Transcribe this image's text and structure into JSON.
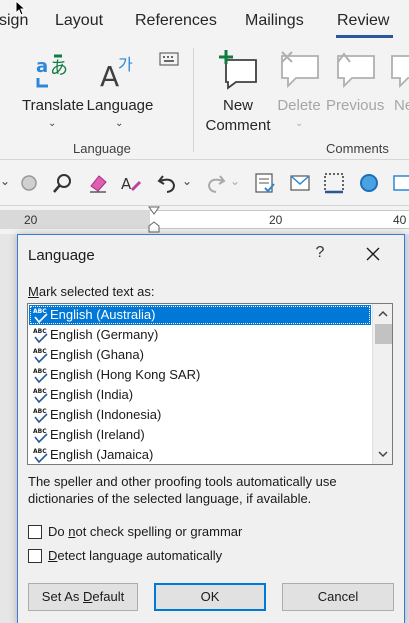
{
  "tabs": {
    "design_partial": "sign",
    "layout": "Layout",
    "references": "References",
    "mailings": "Mailings",
    "review": "Review"
  },
  "ribbon": {
    "translate_label": "Translate",
    "language_label": "Language",
    "language_group": "Language",
    "new_comment_line1": "New",
    "new_comment_line2": "Comment",
    "delete_label": "Delete",
    "previous_label": "Previous",
    "next_partial": "Ne",
    "comments_group": "Comments",
    "caret": "⌄"
  },
  "ruler": {
    "left_num": "20",
    "mid_num": "20",
    "right_num": "40"
  },
  "dialog": {
    "title": "Language",
    "help": "?",
    "mark_label_prefix": "M",
    "mark_label_rest": "ark selected text as:",
    "languages": [
      "English (Australia)",
      "English (Germany)",
      "English (Ghana)",
      "English (Hong Kong SAR)",
      "English (India)",
      "English (Indonesia)",
      "English (Ireland)",
      "English (Jamaica)"
    ],
    "selected_index": 0,
    "info_text": "The speller and other proofing tools automatically use dictionaries of the selected language, if available.",
    "no_check_prefix": "Do ",
    "no_check_u": "n",
    "no_check_rest": "ot check spelling or grammar",
    "detect_u": "D",
    "detect_rest": "etect language automatically",
    "set_default_prefix": "Set As ",
    "set_default_u": "D",
    "set_default_rest": "efault",
    "ok": "OK",
    "cancel": "Cancel"
  },
  "colors": {
    "accent": "#2b579a",
    "selection": "#0078d7",
    "dialog_border": "#3a7bd5"
  },
  "icons": [
    "translate-icon",
    "language-icon",
    "new-comment-icon",
    "delete-comment-icon",
    "previous-comment-icon",
    "next-comment-icon",
    "spelling-abc-icon",
    "close-icon",
    "scroll-up-icon",
    "scroll-down-icon"
  ]
}
